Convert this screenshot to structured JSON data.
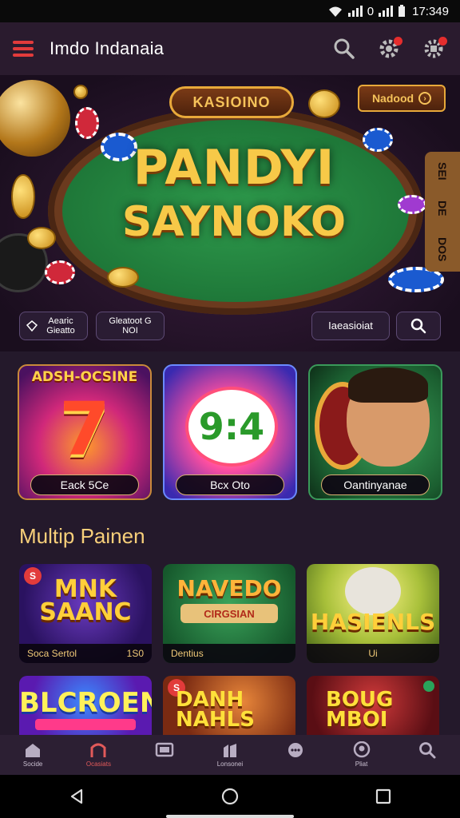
{
  "status_bar": {
    "network": "0",
    "time": "17:349"
  },
  "header": {
    "title": "Imdo Indanaia"
  },
  "hero": {
    "pill_label": "KASIOINO",
    "top_button_label": "Nadood",
    "title_line1": "PANDYI",
    "title_line2": "SAYNOKO",
    "side_tab_top": "SEI",
    "side_tab_mid": "DE",
    "side_tab_bottom": "DOS",
    "mini_1": "Aearic Gieatto",
    "mini_2": "Gleatoot G NOI",
    "mini_3": "Iaeasioiat"
  },
  "games_row1": [
    {
      "top_text": "ADSH-OCSINE",
      "art_text": "7",
      "label": "Eack 5Ce"
    },
    {
      "art_text": "9:4",
      "label": "Bcx Oto"
    },
    {
      "label": "Oantinyanae"
    }
  ],
  "section": {
    "title": "Multip Painen"
  },
  "games_row2": [
    {
      "badge": "S",
      "name_line1": "MNK",
      "name_line2": "SAANC",
      "foot_left": "Soca Sertol",
      "foot_right": "1S0"
    },
    {
      "name_line1": "NAVEDO",
      "sub": "CIRGSIAN",
      "foot_left": "Dentius",
      "foot_right": ""
    },
    {
      "name_line1": "HASIENLS",
      "foot_left": "",
      "foot_right": "Ui"
    }
  ],
  "games_row3": [
    {
      "name_line1": "BLCROEN",
      "strip": "",
      "badge": ""
    },
    {
      "name_line1": "DANH",
      "name_line2": "NAHLS",
      "badge": "S"
    },
    {
      "name_line1": "BOUG",
      "name_line2": "MBOI"
    }
  ],
  "bottom_nav": [
    {
      "icon": "home-icon",
      "label": "Socide"
    },
    {
      "icon": "casino-icon",
      "label": "Ocasiats"
    },
    {
      "icon": "screen-icon",
      "label": ""
    },
    {
      "icon": "building-icon",
      "label": "Lonsonei"
    },
    {
      "icon": "chat-icon",
      "label": ""
    },
    {
      "icon": "profile-icon",
      "label": "Pliat"
    },
    {
      "icon": "search-icon",
      "label": ""
    }
  ],
  "colors": {
    "accent": "#e23b3b",
    "gold": "#f7c948",
    "header_bg": "#2a1b2e",
    "content_bg": "#24192b"
  }
}
